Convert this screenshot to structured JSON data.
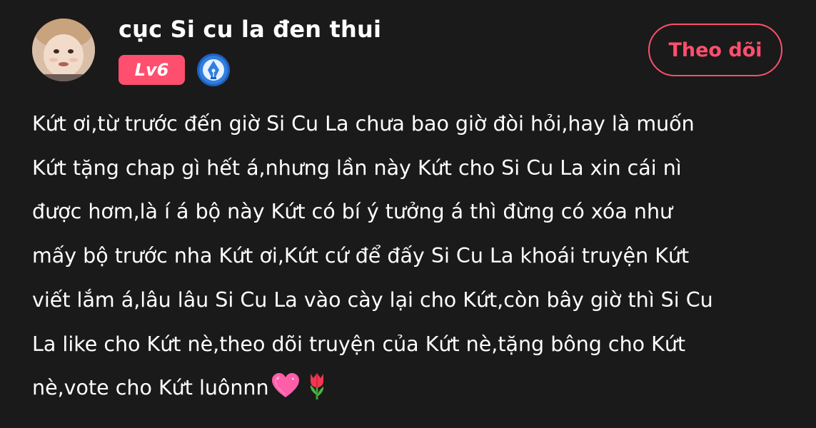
{
  "user": {
    "name": "cục Si cu la đen thui",
    "level": "Lv6",
    "badge_icon": "pen-nib-badge-icon",
    "avatar_icon": "avatar"
  },
  "follow_button": {
    "label": "Theo dõi"
  },
  "comment": {
    "lines": [
      "Kứt ơi,từ trước đến giờ Si Cu La chưa bao giờ đòi hỏi,hay là muốn",
      "Kứt tặng chap gì hết á,nhưng lần này Kứt cho Si Cu La xin cái nì",
      "được hơm,là í á bộ này Kứt có bí ý tưởng á thì đừng có xóa như",
      "mấy bộ trước nha Kứt ơi,Kứt cứ để đấy Si Cu La khoái truyện Kứt",
      "viết lắm á,lâu lâu Si Cu La vào cày lại cho Kứt,còn bây giờ thì Si Cu",
      "La like cho Kứt nè,theo dõi truyện của Kứt nè,tặng bông cho Kứt",
      "nè,vote cho Kứt luônnn"
    ],
    "emojis": [
      "heart-emoji",
      "tulip-emoji"
    ]
  },
  "colors": {
    "background": "#1a1a1a",
    "accent": "#ff4f6e",
    "text": "#ffffff",
    "badge_blue": "#2f7fe0"
  }
}
